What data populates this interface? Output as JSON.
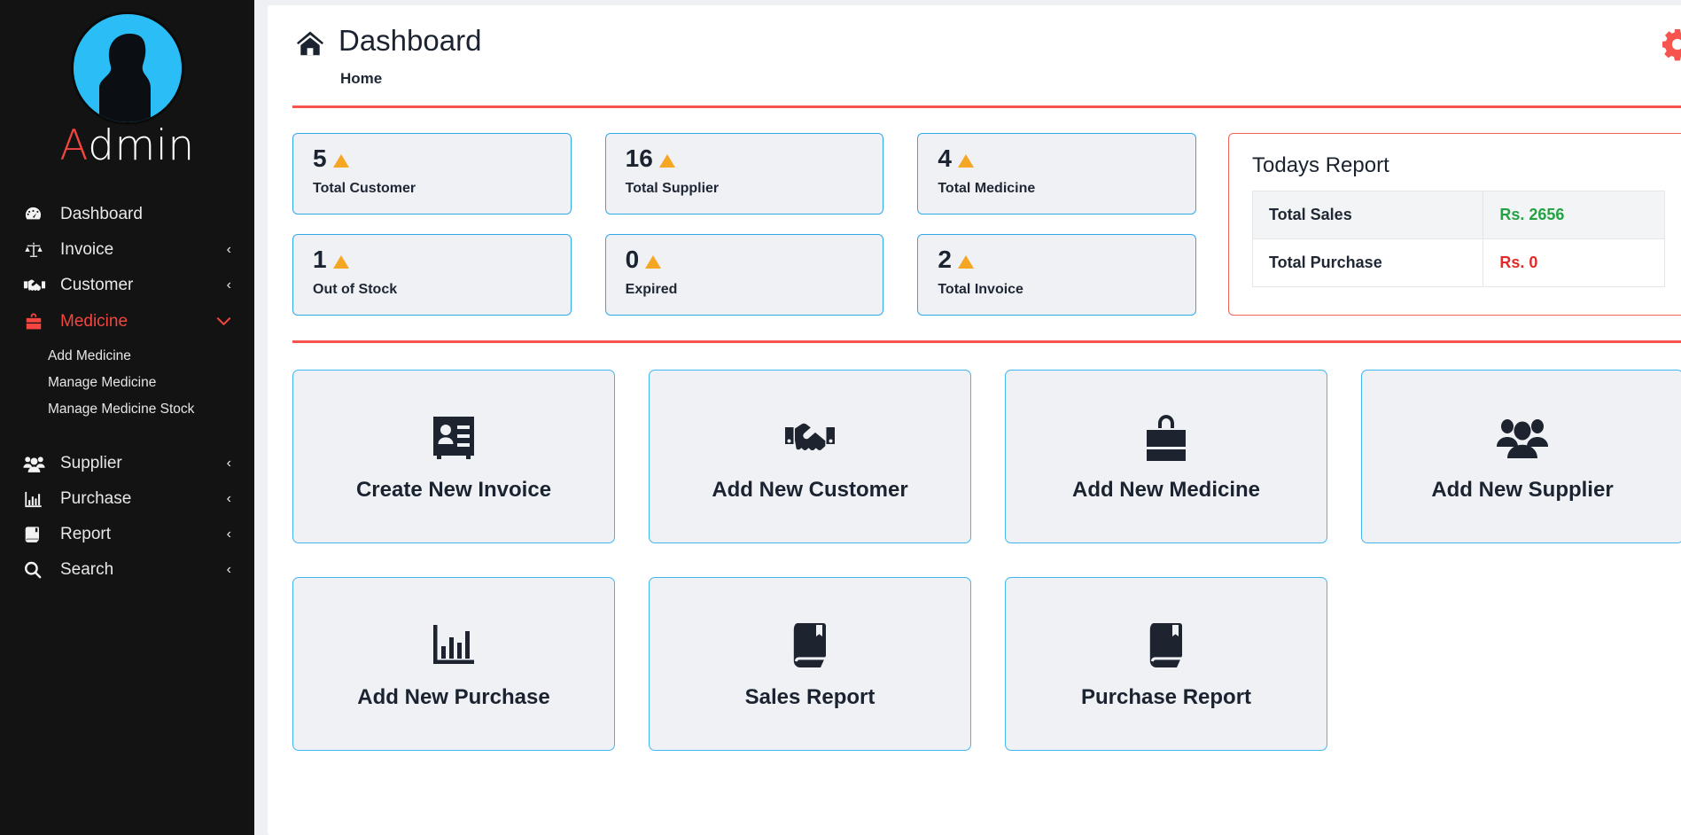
{
  "sidebar": {
    "brand": {
      "initial": "A",
      "rest": "dmin",
      "avatar_icon": "user-silhouette-avatar"
    },
    "items": [
      {
        "label": "Dashboard",
        "icon": "speedometer-icon",
        "chevron": "",
        "active": false
      },
      {
        "label": "Invoice",
        "icon": "balance-scale-icon",
        "chevron": "‹",
        "active": false
      },
      {
        "label": "Customer",
        "icon": "handshake-icon",
        "chevron": "‹",
        "active": false
      },
      {
        "label": "Medicine",
        "icon": "medicine-bag-icon",
        "chevron": "⌄",
        "active": true
      },
      {
        "label": "Supplier",
        "icon": "users-icon",
        "chevron": "‹",
        "active": false
      },
      {
        "label": "Purchase",
        "icon": "bar-chart-icon",
        "chevron": "‹",
        "active": false
      },
      {
        "label": "Report",
        "icon": "book-icon",
        "chevron": "‹",
        "active": false
      },
      {
        "label": "Search",
        "icon": "search-icon",
        "chevron": "‹",
        "active": false
      }
    ],
    "medicine_submenu": [
      "Add Medicine",
      "Manage Medicine",
      "Manage Medicine Stock"
    ]
  },
  "header": {
    "home_icon": "home-icon",
    "title": "Dashboard",
    "breadcrumb": "Home",
    "settings_icon": "gear-icon",
    "settings_color": "#f8544f",
    "divider_color": "#f8544f"
  },
  "stats": {
    "row1": [
      {
        "value": "5",
        "label": "Total Customer"
      },
      {
        "value": "16",
        "label": "Total Supplier"
      },
      {
        "value": "4",
        "label": "Total Medicine"
      }
    ],
    "row2": [
      {
        "value": "1",
        "label": "Out of Stock"
      },
      {
        "value": "0",
        "label": "Expired"
      },
      {
        "value": "2",
        "label": "Total Invoice"
      }
    ],
    "marker_color": "#f5a623",
    "border_color": "#2fa8e8"
  },
  "todays_report": {
    "title": "Todays Report",
    "rows": [
      {
        "key": "Total Sales",
        "value": "Rs. 2656",
        "color": "#25a244"
      },
      {
        "key": "Total Purchase",
        "value": "Rs. 0",
        "color": "#e02b2b"
      }
    ]
  },
  "tiles": {
    "row1": [
      {
        "label": "Create New Invoice",
        "icon": "id-card-icon"
      },
      {
        "label": "Add New Customer",
        "icon": "handshake-icon"
      },
      {
        "label": "Add New Medicine",
        "icon": "shopping-bag-icon"
      },
      {
        "label": "Add New Supplier",
        "icon": "users-icon"
      }
    ],
    "row2": [
      {
        "label": "Add New Purchase",
        "icon": "bar-chart-icon"
      },
      {
        "label": "Sales Report",
        "icon": "book-icon"
      },
      {
        "label": "Purchase Report",
        "icon": "book-icon"
      }
    ]
  }
}
